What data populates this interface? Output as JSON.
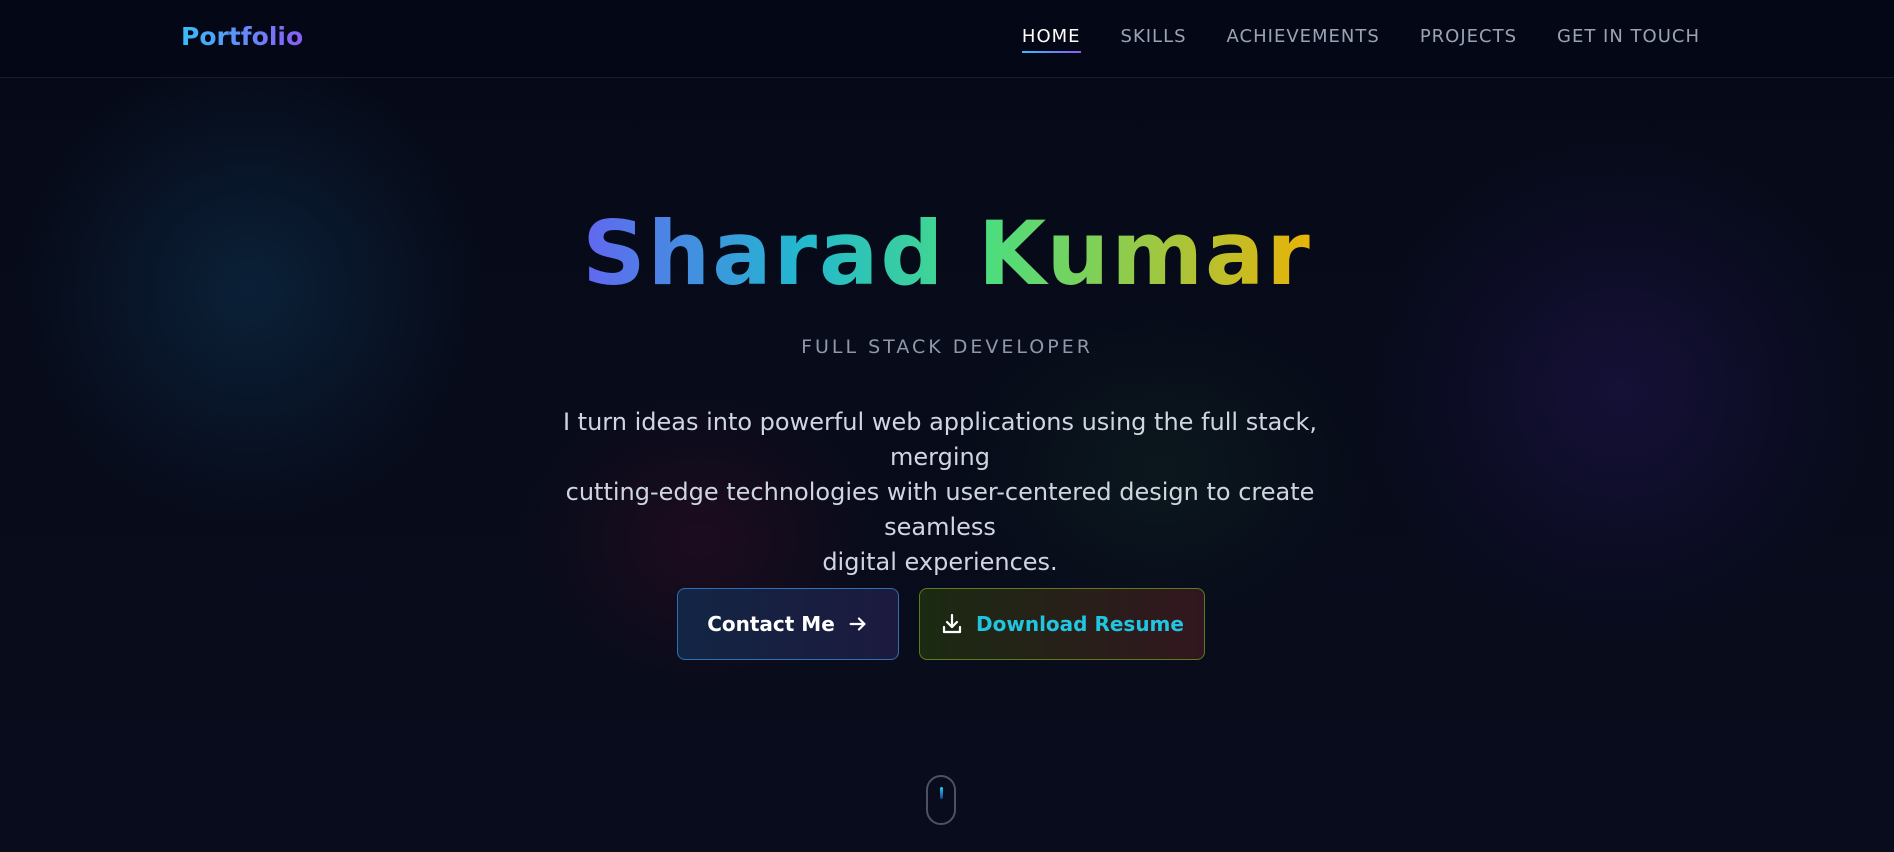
{
  "header": {
    "logo": "Portfolio",
    "nav": [
      {
        "label": "HOME",
        "active": true
      },
      {
        "label": "SKILLS",
        "active": false
      },
      {
        "label": "ACHIEVEMENTS",
        "active": false
      },
      {
        "label": "PROJECTS",
        "active": false
      },
      {
        "label": "GET IN TOUCH",
        "active": false
      }
    ]
  },
  "hero": {
    "name": "Sharad Kumar",
    "role": "FULL STACK DEVELOPER",
    "description_lines": [
      "I turn ideas into powerful web applications using the full stack, merging",
      "cutting-edge technologies with user-centered design to create seamless",
      "digital experiences."
    ],
    "contact_button": {
      "label": "Contact Me",
      "icon": "arrow-right-icon"
    },
    "resume_button": {
      "label": "Download Resume",
      "icon": "download-icon"
    }
  },
  "scroll_indicator": {
    "icon": "mouse-scroll-icon"
  },
  "colors": {
    "background": "#060a18",
    "accent_cyan": "#22c5e0",
    "accent_purple": "#8b5cf6",
    "name_gradient": [
      "#6366f1",
      "#22b8cf",
      "#4ade80",
      "#eab308"
    ]
  }
}
